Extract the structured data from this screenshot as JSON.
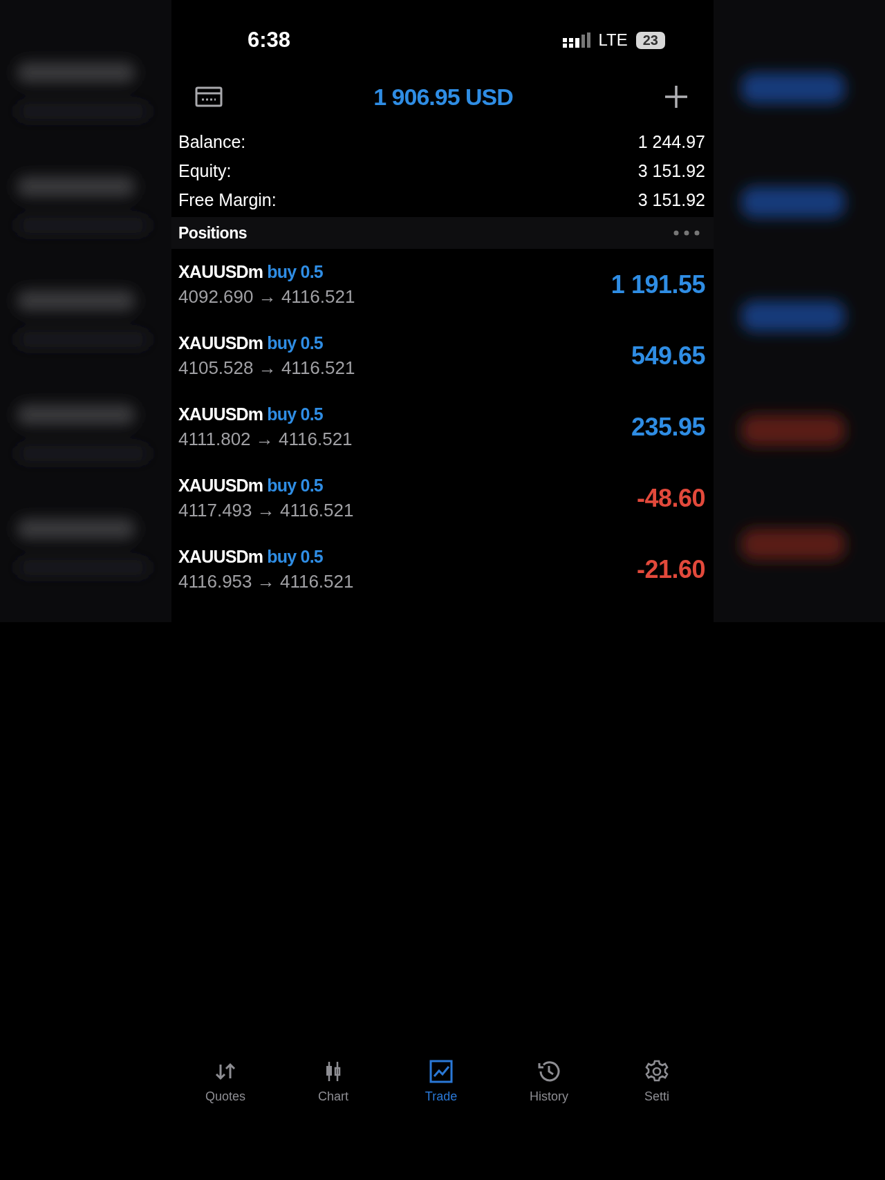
{
  "status_bar": {
    "time": "6:38",
    "network": "LTE",
    "battery": "23"
  },
  "header": {
    "title": "1 906.95 USD"
  },
  "summary": [
    {
      "label": "Balance:",
      "value": "1 244.97"
    },
    {
      "label": "Equity:",
      "value": "3 151.92"
    },
    {
      "label": "Free Margin:",
      "value": "3 151.92"
    }
  ],
  "positions": {
    "title": "Positions",
    "rows": [
      {
        "symbol": "XAUUSDm",
        "side": "buy 0.5",
        "prices": "4092.690 → 4116.521",
        "profit": "1 191.55",
        "kind": "profit"
      },
      {
        "symbol": "XAUUSDm",
        "side": "buy 0.5",
        "prices": "4105.528 → 4116.521",
        "profit": "549.65",
        "kind": "profit"
      },
      {
        "symbol": "XAUUSDm",
        "side": "buy 0.5",
        "prices": "4111.802 → 4116.521",
        "profit": "235.95",
        "kind": "profit"
      },
      {
        "symbol": "XAUUSDm",
        "side": "buy 0.5",
        "prices": "4117.493 → 4116.521",
        "profit": "-48.60",
        "kind": "loss"
      },
      {
        "symbol": "XAUUSDm",
        "side": "buy 0.5",
        "prices": "4116.953 → 4116.521",
        "profit": "-21.60",
        "kind": "loss"
      }
    ]
  },
  "tab_bar": [
    {
      "label": "Quotes",
      "selected": false,
      "kind": "quotes"
    },
    {
      "label": "Chart",
      "selected": false,
      "kind": "chart"
    },
    {
      "label": "Trade",
      "selected": true,
      "kind": "trade"
    },
    {
      "label": "History",
      "selected": false,
      "kind": "history"
    },
    {
      "label": "Setti",
      "selected": false,
      "kind": "settings"
    }
  ]
}
